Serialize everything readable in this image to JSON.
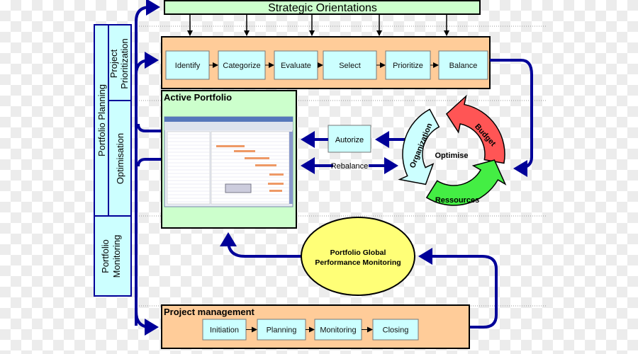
{
  "strategic": "Strategic Orientations",
  "prioritization_steps": [
    "Identify",
    "Categorize",
    "Evaluate",
    "Select",
    "Prioritize",
    "Balance"
  ],
  "left_column": {
    "portfolio_planning": "Portfolio Planning",
    "project_prioritization_1": "Project",
    "project_prioritization_2": "Prioritization",
    "optimisation": "Optimisation",
    "portfolio_monitoring_1": "Portfolio",
    "portfolio_monitoring_2": "Monitoring"
  },
  "active_portfolio": "Active Portfolio",
  "autorize": "Autorize",
  "rebalance": "Rebalance",
  "cycle": {
    "center": "Optimise",
    "budget": "Budget",
    "organization": "Organization",
    "resources": "Ressources"
  },
  "monitoring_ellipse": {
    "line1": "Portfolio Global",
    "line2": "Performance Monitoring"
  },
  "project_management": {
    "title": "Project management",
    "steps": [
      "Initiation",
      "Planning",
      "Monitoring",
      "Closing"
    ]
  },
  "colors": {
    "arrow": "#000099",
    "green_box": "#ccffcc",
    "orange_box": "#ffcc99",
    "cyan_box": "#ccffff",
    "yellow": "#ffff77",
    "red": "#ff5555",
    "green": "#44ee44"
  }
}
